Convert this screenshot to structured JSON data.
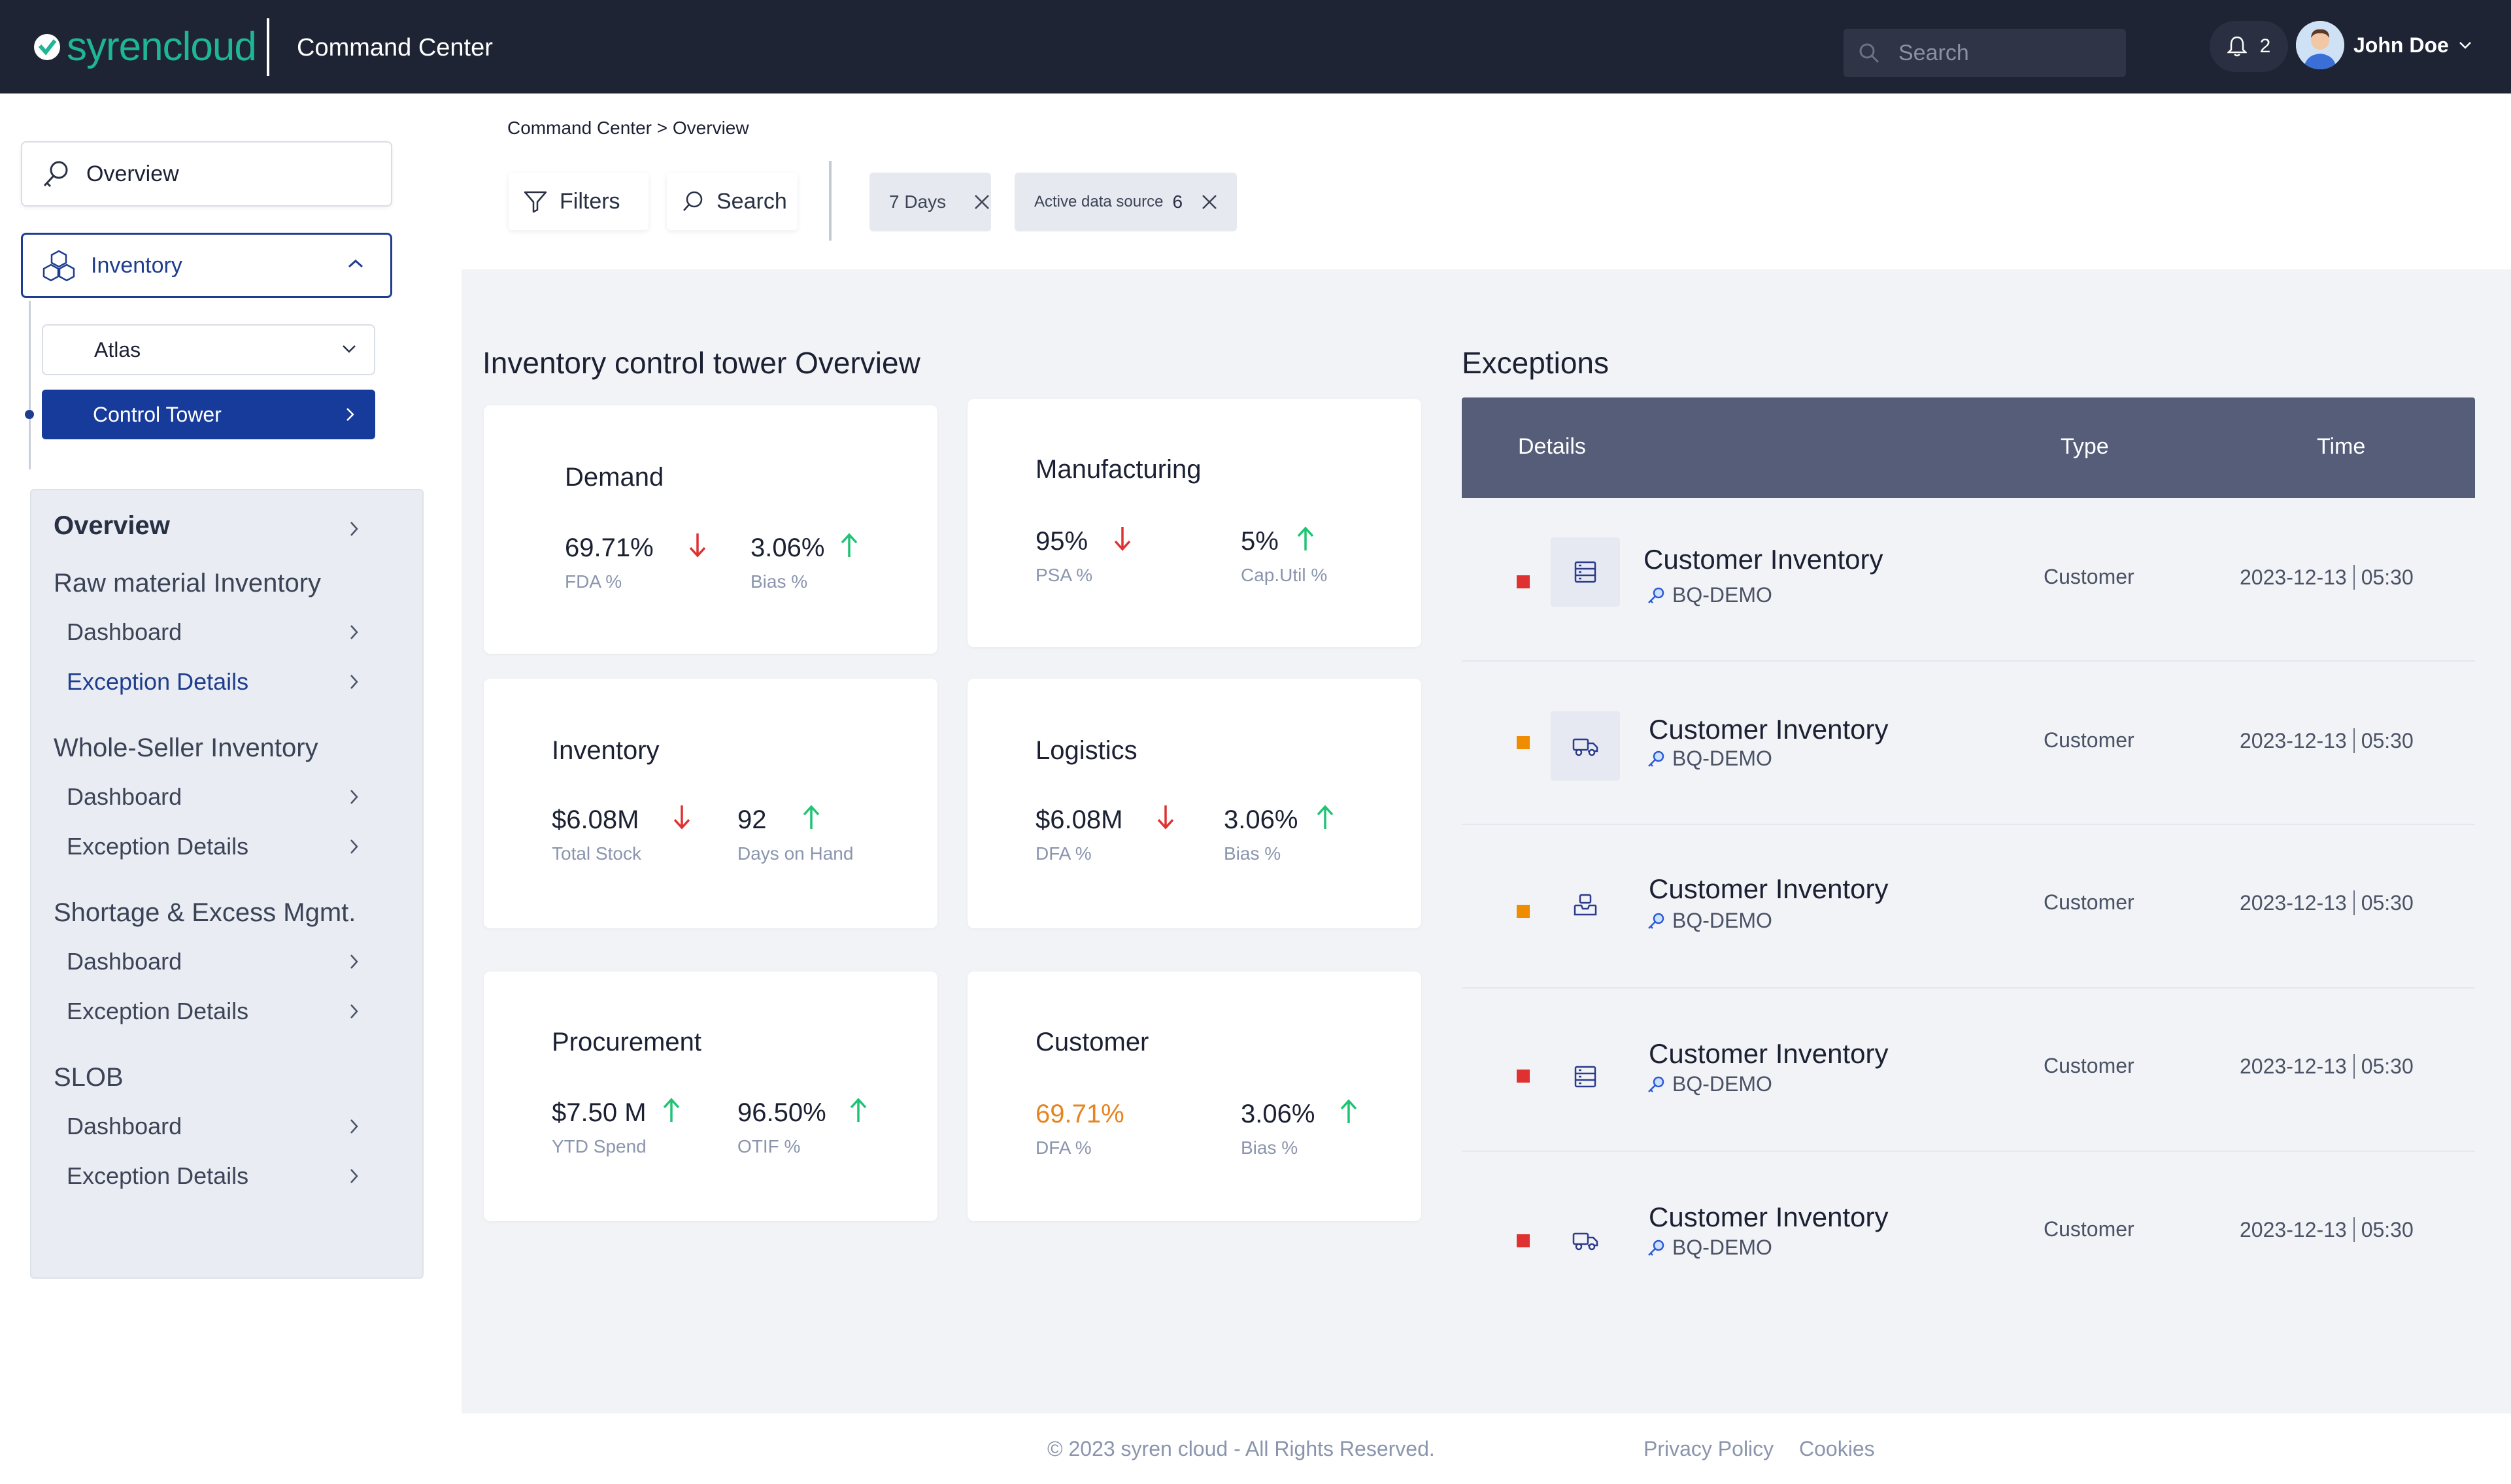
{
  "header": {
    "logo_text": "syrencloud",
    "app_title": "Command Center",
    "search_placeholder": "Search",
    "notification_count": "2",
    "user_name": "John Doe"
  },
  "sidebar": {
    "overview_label": "Overview",
    "inventory_label": "Inventory",
    "atlas_label": "Atlas",
    "control_tower_label": "Control Tower",
    "subnav": {
      "overview": "Overview",
      "groups": [
        {
          "title": "Raw material Inventory",
          "items": [
            "Dashboard",
            "Exception  Details"
          ]
        },
        {
          "title": "Whole-Seller Inventory",
          "items": [
            "Dashboard",
            "Exception  Details"
          ]
        },
        {
          "title": "Shortage & Excess Mgmt.",
          "items": [
            "Dashboard",
            "Exception  Details"
          ]
        },
        {
          "title": "SLOB",
          "items": [
            "Dashboard",
            "Exception  Details"
          ]
        }
      ]
    }
  },
  "breadcrumb": "Command Center > Overview",
  "toolbar": {
    "filters_label": "Filters",
    "search_label": "Search",
    "chips": [
      {
        "label": "7 Days",
        "count": ""
      },
      {
        "label": "Active data source",
        "count": "6"
      }
    ]
  },
  "overview": {
    "title": "Inventory control tower  Overview",
    "cards": [
      {
        "title": "Demand",
        "metrics": [
          {
            "value": "69.71%",
            "label": "FDA %",
            "trend": "down"
          },
          {
            "value": "3.06%",
            "label": "Bias %",
            "trend": "up"
          }
        ]
      },
      {
        "title": "Manufacturing",
        "metrics": [
          {
            "value": "95%",
            "label": "PSA %",
            "trend": "down"
          },
          {
            "value": "5%",
            "label": "Cap.Util %",
            "trend": "up"
          }
        ]
      },
      {
        "title": "Inventory",
        "metrics": [
          {
            "value": "$6.08M",
            "label": "Total Stock",
            "trend": "down"
          },
          {
            "value": "92",
            "label": "Days on Hand",
            "trend": "up"
          }
        ]
      },
      {
        "title": "Logistics",
        "metrics": [
          {
            "value": "$6.08M",
            "label": "DFA %",
            "trend": "down"
          },
          {
            "value": "3.06%",
            "label": "Bias %",
            "trend": "up"
          }
        ]
      },
      {
        "title": "Procurement",
        "metrics": [
          {
            "value": "$7.50 M",
            "label": "YTD Spend",
            "trend": "up"
          },
          {
            "value": "96.50%",
            "label": "OTIF %",
            "trend": "up"
          }
        ]
      },
      {
        "title": "Customer",
        "metrics": [
          {
            "value": "69.71%",
            "label": "DFA %",
            "trend": "none",
            "highlight": "#e8841f"
          },
          {
            "value": "3.06%",
            "label": "Bias %",
            "trend": "up"
          }
        ]
      }
    ]
  },
  "exceptions": {
    "title": "Exceptions",
    "columns": [
      "Details",
      "Type",
      "Time"
    ],
    "rows": [
      {
        "name": "Customer Inventory",
        "source": "BQ-DEMO",
        "type": "Customer",
        "date": "2023-12-13",
        "time": "05:30",
        "severity_color": "#e03131",
        "icon": "server-icon"
      },
      {
        "name": "Customer Inventory",
        "source": "BQ-DEMO",
        "type": "Customer",
        "date": "2023-12-13",
        "time": "05:30",
        "severity_color": "#f08c00",
        "icon": "truck-icon"
      },
      {
        "name": "Customer Inventory",
        "source": "BQ-DEMO",
        "type": "Customer",
        "date": "2023-12-13",
        "time": "05:30",
        "severity_color": "#f08c00",
        "icon": "inbox-icon"
      },
      {
        "name": "Customer Inventory",
        "source": "BQ-DEMO",
        "type": "Customer",
        "date": "2023-12-13",
        "time": "05:30",
        "severity_color": "#e03131",
        "icon": "server-icon"
      },
      {
        "name": "Customer Inventory",
        "source": "BQ-DEMO",
        "type": "Customer",
        "date": "2023-12-13",
        "time": "05:30",
        "severity_color": "#e03131",
        "icon": "truck-icon"
      }
    ]
  },
  "footer": {
    "copyright": "© 2023 syren cloud - All Rights Reserved.",
    "privacy": "Privacy Policy",
    "cookies": "Cookies"
  },
  "colors": {
    "topbar": "#1e2434",
    "brand": "#1fb597",
    "accent": "#163b9a",
    "down": "#e03131",
    "up": "#20c374",
    "table_header": "#565d79"
  }
}
